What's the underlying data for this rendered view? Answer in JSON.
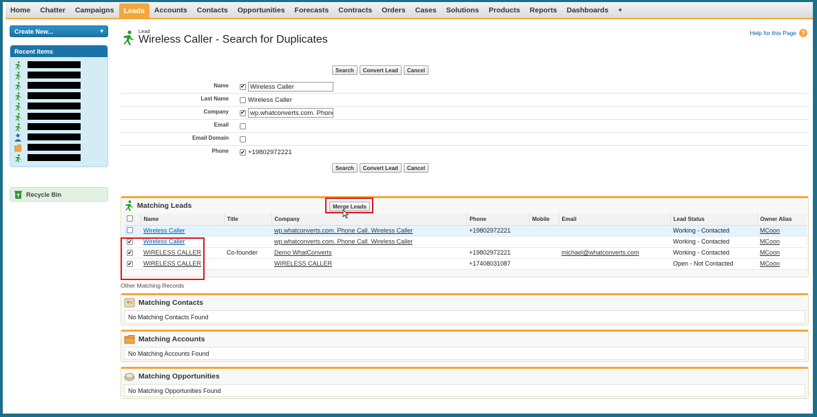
{
  "tabs": [
    "Home",
    "Chatter",
    "Campaigns",
    "Leads",
    "Accounts",
    "Contacts",
    "Opportunities",
    "Forecasts",
    "Contracts",
    "Orders",
    "Cases",
    "Solutions",
    "Products",
    "Reports",
    "Dashboards",
    "+"
  ],
  "active_tab": "Leads",
  "sidebar": {
    "create_new": "Create New...",
    "recent_items_title": "Recent Items",
    "recent_items": [
      {
        "icon": "lead-icon"
      },
      {
        "icon": "lead-icon"
      },
      {
        "icon": "lead-icon"
      },
      {
        "icon": "lead-icon"
      },
      {
        "icon": "lead-icon"
      },
      {
        "icon": "lead-icon"
      },
      {
        "icon": "lead-icon"
      },
      {
        "icon": "contact-icon"
      },
      {
        "icon": "account-icon"
      },
      {
        "icon": "lead-icon"
      }
    ],
    "recycle_bin": "Recycle Bin"
  },
  "header": {
    "object_type": "Lead",
    "title": "Wireless Caller - Search for Duplicates",
    "help": "Help for this Page"
  },
  "buttons": {
    "search": "Search",
    "convert_lead": "Convert Lead",
    "cancel": "Cancel",
    "merge_leads": "Merge Leads"
  },
  "criteria": {
    "name": {
      "label": "Name",
      "checked": true,
      "value": "Wireless Caller"
    },
    "last_name": {
      "label": "Last Name",
      "checked": false,
      "value": "Wireless Caller"
    },
    "company": {
      "label": "Company",
      "checked": true,
      "value": "wp.whatconverts.com. Phone"
    },
    "email": {
      "label": "Email",
      "checked": false,
      "value": ""
    },
    "email_domain": {
      "label": "Email Domain",
      "checked": false,
      "value": ""
    },
    "phone": {
      "label": "Phone",
      "checked": true,
      "value": "+19802972221"
    }
  },
  "matching_leads": {
    "title": "Matching Leads",
    "columns": [
      "Name",
      "Title",
      "Company",
      "Phone",
      "Mobile",
      "Email",
      "Lead Status",
      "Owner Alias"
    ],
    "rows": [
      {
        "checked": false,
        "name": "Wireless Caller",
        "title": "",
        "company": "wp.whatconverts.com. Phone Call. Wireless Caller",
        "phone": "+19802972221",
        "mobile": "",
        "email": "",
        "status": "Working - Contacted",
        "owner": "MCoon"
      },
      {
        "checked": true,
        "name": "Wireless Caller",
        "title": "",
        "company": "wp.whatconverts.com. Phone Call. Wireless Caller",
        "phone": "",
        "mobile": "",
        "email": "",
        "status": "Working - Contacted",
        "owner": "MCoon"
      },
      {
        "checked": true,
        "name": "WIRELESS CALLER",
        "title": "Co-founder",
        "company": "Demo WhatConverts",
        "phone": "+19802972221",
        "mobile": "",
        "email": "michael@whatconverts.com",
        "status": "Working - Contacted",
        "owner": "MCoon"
      },
      {
        "checked": true,
        "name": "WIRELESS CALLER",
        "title": "",
        "company": "WIRELESS CALLER",
        "phone": "+17408031087",
        "mobile": "",
        "email": "",
        "status": "Open - Not Contacted",
        "owner": "MCoon"
      }
    ]
  },
  "other_matching": "Other Matching Records",
  "matching_contacts": {
    "title": "Matching Contacts",
    "empty": "No Matching Contacts Found"
  },
  "matching_accounts": {
    "title": "Matching Accounts",
    "empty": "No Matching Accounts Found"
  },
  "matching_opportunities": {
    "title": "Matching Opportunities",
    "empty": "No Matching Opportunities Found"
  },
  "colors": {
    "accent": "#f3a73b",
    "brand_blue": "#1b73a8",
    "highlight": "#e0141e"
  }
}
